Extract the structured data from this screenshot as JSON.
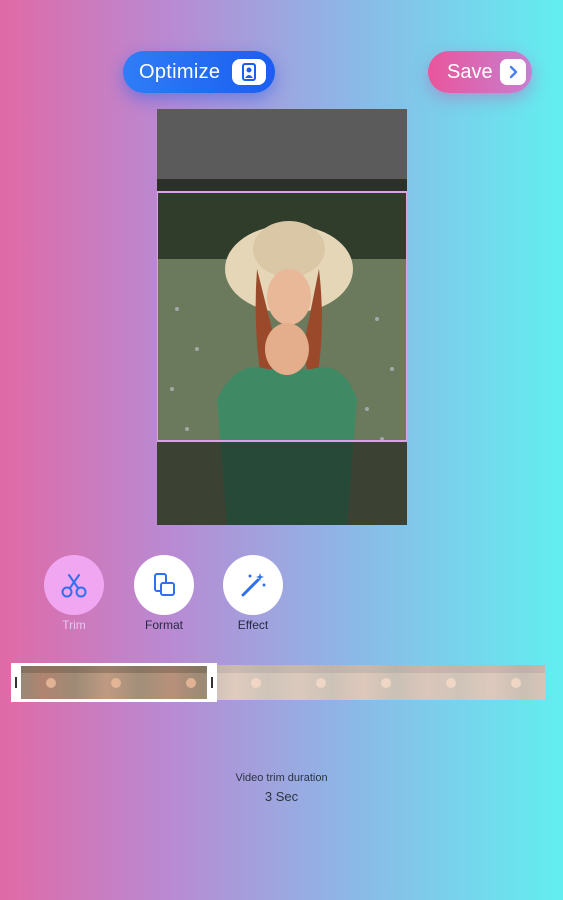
{
  "header": {
    "optimize_label": "Optimize",
    "optimize_icon": "person-scan-icon",
    "save_label": "Save",
    "save_icon": "chevron-right-icon"
  },
  "tools": [
    {
      "label": "Trim",
      "icon": "scissors-icon",
      "active": true
    },
    {
      "label": "Format",
      "icon": "format-icon",
      "active": false
    },
    {
      "label": "Effect",
      "icon": "magic-wand-icon",
      "active": false
    }
  ],
  "trim": {
    "duration_label": "Video trim duration",
    "duration_value": "3 Sec"
  },
  "colors": {
    "accent_blue": "#1a5ef0",
    "accent_pink": "#e9559c",
    "trim_active": "#f0a6f0"
  }
}
